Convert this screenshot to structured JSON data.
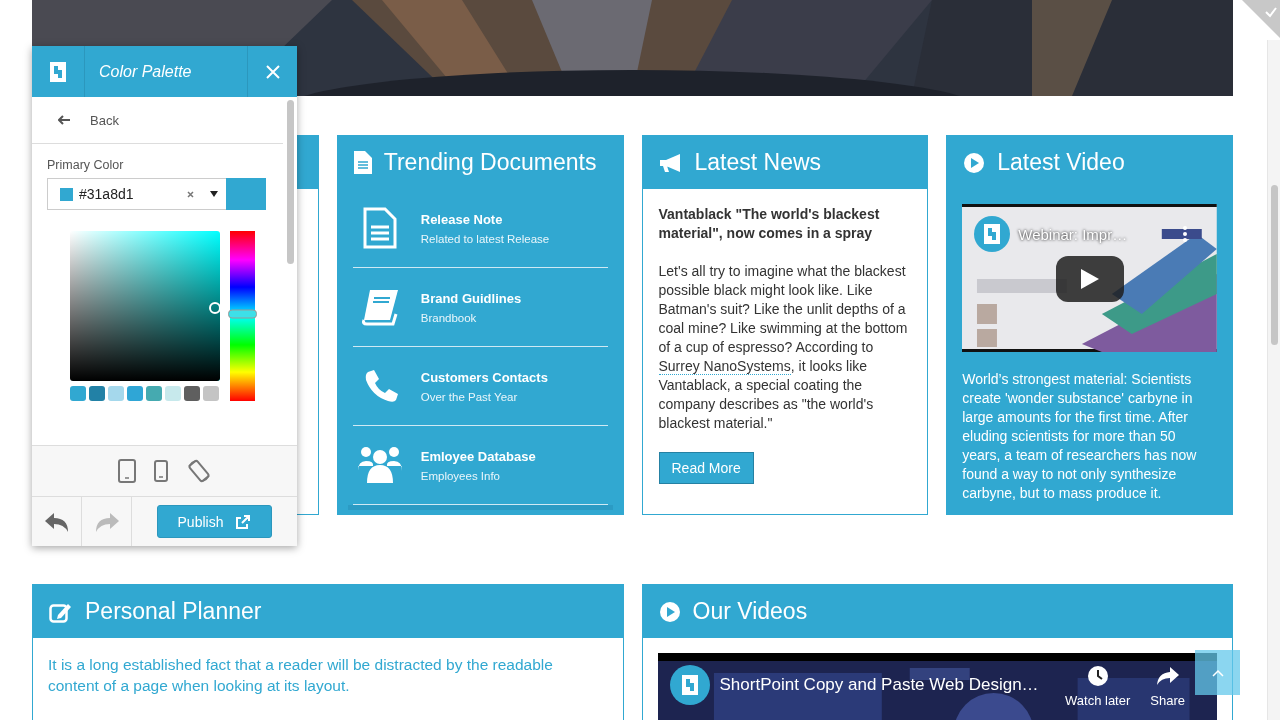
{
  "panel": {
    "title": "Color Palette",
    "back": "Back",
    "field_label": "Primary Color",
    "color_value": "#31a8d1",
    "hue": {
      "level": 0.49
    },
    "swatches": [
      {
        "color": "#31a8d1"
      },
      {
        "color": "#2281a6"
      },
      {
        "color": "#a5d8ec"
      },
      {
        "color": "#2fa6d6"
      },
      {
        "color": "#45aab0"
      },
      {
        "color": "#c7e9ec"
      },
      {
        "color": "#5f5f5f"
      },
      {
        "color": "#c4c4c4"
      }
    ],
    "undo": {
      "disabled": false
    },
    "redo": {
      "disabled": true
    },
    "publish": "Publish"
  },
  "cards": [
    {
      "kind": "documents",
      "title": "Trending Documents",
      "items": [
        {
          "kind": "file",
          "title": "Release Note",
          "subtitle": "Related to latest Release"
        },
        {
          "kind": "book",
          "title": "Brand Guidlines",
          "subtitle": "Brandbook"
        },
        {
          "kind": "phone",
          "title": "Customers Contacts",
          "subtitle": "Over the Past Year"
        },
        {
          "kind": "people",
          "title": "Emloyee Database",
          "subtitle": "Employees Info"
        }
      ]
    },
    {
      "kind": "news",
      "title": "Latest News",
      "headline": "Vantablack \"The world's blackest material\", now comes in a spray",
      "body_before": "Let's all try to imagine what the blackest possible black might look like. Like Batman's suit? Like the unlit depths of a coal mine? Like swimming at the bottom of a cup of espresso? According to ",
      "link": "Surrey NanoSystems",
      "body_after": ", it looks like Vantablack, a special coating the company describes as \"the world's blackest material.\"",
      "button": "Read More"
    },
    {
      "kind": "video",
      "title": "Latest Video",
      "video_title": "Webinar: Impr…",
      "text": "World’s strongest material: Scientists create 'wonder substance' carbyne in large amounts for the first time. After eluding scientists for more than 50 years, a team of researchers has now found a way to not only synthesize carbyne, but to mass produce it."
    }
  ],
  "planner": {
    "title": "Personal Planner",
    "text": "It is a long established fact that a reader will be distracted by the readable content of a page when looking at its layout."
  },
  "videos": {
    "title": "Our Videos",
    "video_title": "ShortPoint Copy and Paste Web Design…",
    "actions": [
      {
        "kind": "clock",
        "label": "Watch later"
      },
      {
        "kind": "share",
        "label": "Share"
      }
    ]
  }
}
